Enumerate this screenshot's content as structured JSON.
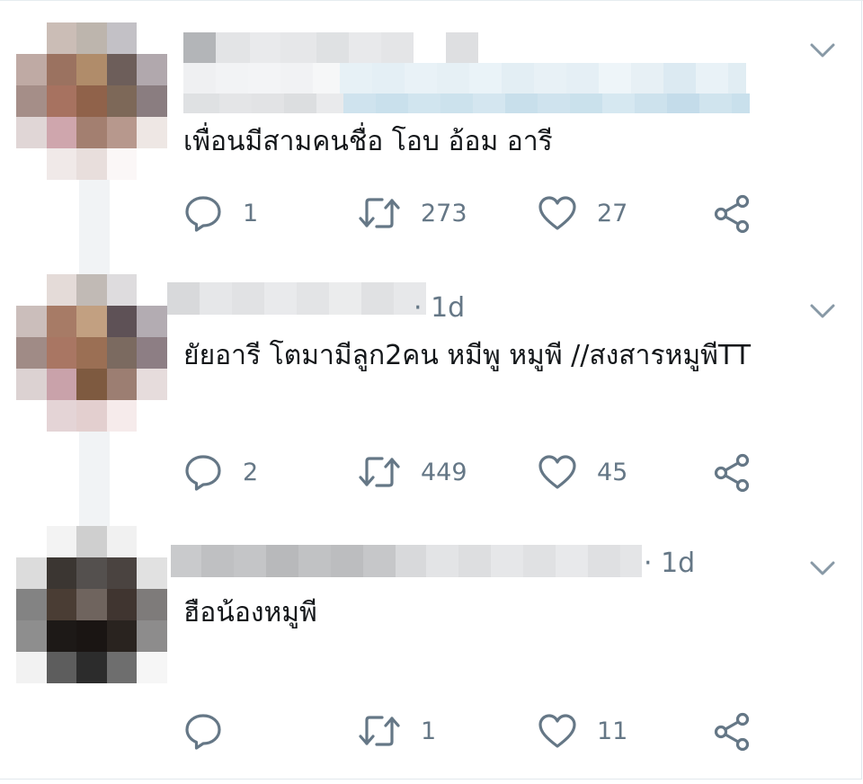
{
  "tweets": [
    {
      "time": "",
      "text": "เพื่อนมีสามคนชื่อ โอบ อ้อม อารี",
      "replies": "1",
      "retweets": "273",
      "likes": "27"
    },
    {
      "time": "· 1d",
      "text": "ยัยอารี โตมามีลูก2คน หมีพู หมูพี //สงสารหมูพีTT",
      "replies": "2",
      "retweets": "449",
      "likes": "45"
    },
    {
      "time": "· 1d",
      "text": "ฮือน้องหมูพี",
      "replies": "",
      "retweets": "1",
      "likes": "11"
    }
  ],
  "icons": {
    "reply": "reply-icon",
    "retweet": "retweet-icon",
    "like": "heart-icon",
    "share": "share-icon",
    "menu": "chevron-down-icon"
  },
  "colors": {
    "text": "#14171a",
    "muted": "#657786",
    "icon": "#657786",
    "divider": "#e6ecf0"
  }
}
